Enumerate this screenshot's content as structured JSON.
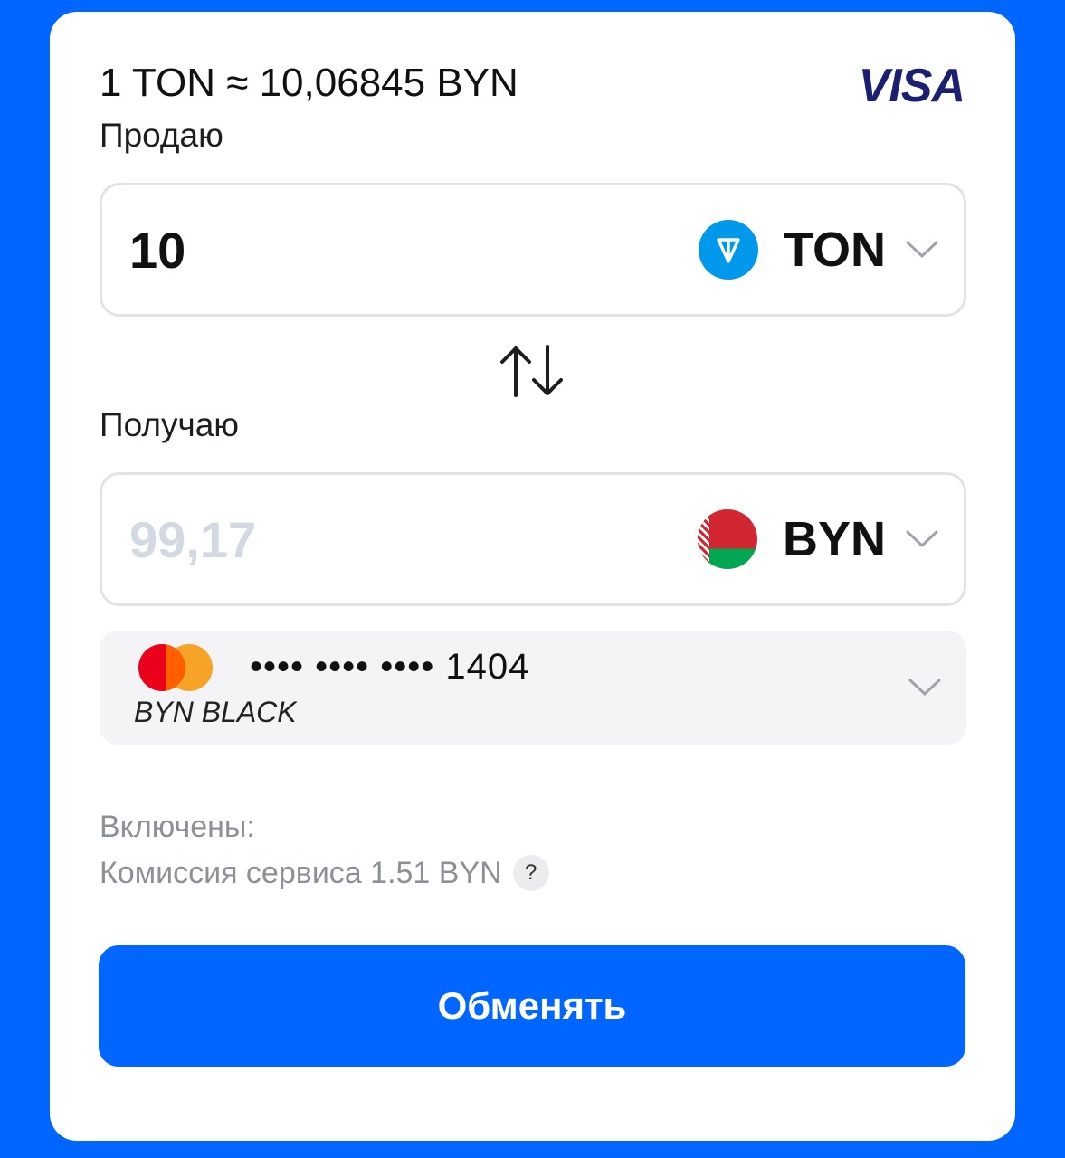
{
  "header": {
    "rate": "1 TON ≈ 10,06845 BYN",
    "brand": "VISA"
  },
  "sell": {
    "label": "Продаю",
    "amount": "10",
    "currency": "TON"
  },
  "receive": {
    "label": "Получаю",
    "amount_placeholder": "99,17",
    "currency": "BYN"
  },
  "card": {
    "masked_number": "•••• •••• •••• 1404",
    "name": "BYN BLACK"
  },
  "fees": {
    "included_label": "Включены:",
    "service_fee": "Комиссия сервиса 1.51 BYN",
    "help": "?"
  },
  "submit_label": "Обменять",
  "colors": {
    "accent": "#0066ff",
    "ton": "#0098ea",
    "visa": "#1a1f71"
  }
}
